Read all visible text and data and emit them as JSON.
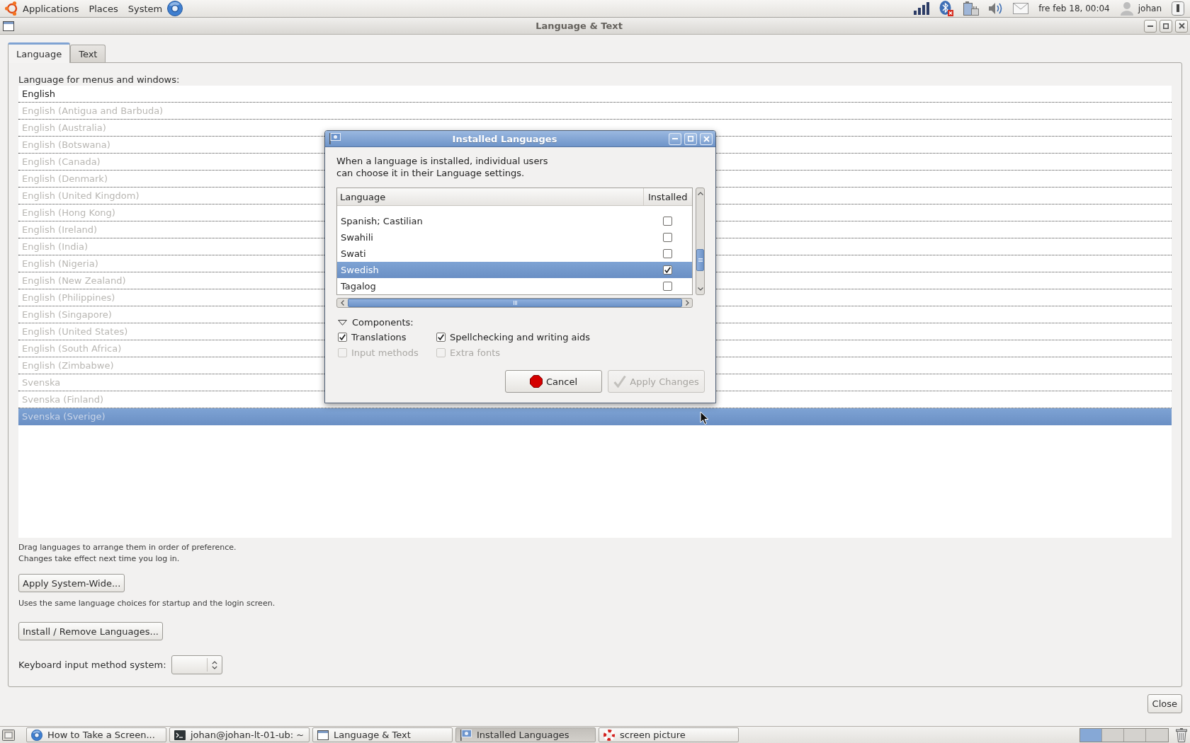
{
  "top_panel": {
    "menus": [
      "Applications",
      "Places",
      "System"
    ],
    "clock": "fre feb 18, 00:04",
    "user": "johan"
  },
  "window": {
    "title": "Language & Text",
    "tabs": [
      {
        "label": "Language",
        "selected": true
      },
      {
        "label": "Text",
        "selected": false
      }
    ],
    "list_label": "Language for menus and windows:",
    "languages": [
      {
        "name": "English",
        "disabled": false,
        "selected": false
      },
      {
        "name": "English (Antigua and Barbuda)",
        "disabled": true,
        "selected": false
      },
      {
        "name": "English (Australia)",
        "disabled": true,
        "selected": false
      },
      {
        "name": "English (Botswana)",
        "disabled": true,
        "selected": false
      },
      {
        "name": "English (Canada)",
        "disabled": true,
        "selected": false
      },
      {
        "name": "English (Denmark)",
        "disabled": true,
        "selected": false
      },
      {
        "name": "English (United Kingdom)",
        "disabled": true,
        "selected": false
      },
      {
        "name": "English (Hong Kong)",
        "disabled": true,
        "selected": false
      },
      {
        "name": "English (Ireland)",
        "disabled": true,
        "selected": false
      },
      {
        "name": "English (India)",
        "disabled": true,
        "selected": false
      },
      {
        "name": "English (Nigeria)",
        "disabled": true,
        "selected": false
      },
      {
        "name": "English (New Zealand)",
        "disabled": true,
        "selected": false
      },
      {
        "name": "English (Philippines)",
        "disabled": true,
        "selected": false
      },
      {
        "name": "English (Singapore)",
        "disabled": true,
        "selected": false
      },
      {
        "name": "English (United States)",
        "disabled": true,
        "selected": false
      },
      {
        "name": "English (South Africa)",
        "disabled": true,
        "selected": false
      },
      {
        "name": "English (Zimbabwe)",
        "disabled": true,
        "selected": false
      },
      {
        "name": "Svenska",
        "disabled": true,
        "selected": false
      },
      {
        "name": "Svenska (Finland)",
        "disabled": true,
        "selected": false
      },
      {
        "name": "Svenska (Sverige)",
        "disabled": true,
        "selected": true
      }
    ],
    "hint": "Drag languages to arrange them in order of preference.\nChanges take effect next time you log in.",
    "apply_button": "Apply System-Wide...",
    "apply_note": "Uses the same language choices for startup and the login screen.",
    "install_button": "Install / Remove Languages...",
    "keyboard_label": "Keyboard input method system:",
    "close_button": "Close"
  },
  "dialog": {
    "title": "Installed Languages",
    "description": "When a language is installed, individual users\ncan choose it in their Language settings.",
    "columns": [
      "Language",
      "Installed"
    ],
    "rows": [
      {
        "name": "Spanish; Castilian",
        "checked": false,
        "selected": false
      },
      {
        "name": "Swahili",
        "checked": false,
        "selected": false
      },
      {
        "name": "Swati",
        "checked": false,
        "selected": false
      },
      {
        "name": "Swedish",
        "checked": true,
        "selected": true
      },
      {
        "name": "Tagalog",
        "checked": false,
        "selected": false
      }
    ],
    "components": {
      "label": "Components:",
      "expanded": true,
      "options": [
        {
          "label": "Translations",
          "checked": true,
          "disabled": false
        },
        {
          "label": "Spellchecking and writing aids",
          "checked": true,
          "disabled": false
        },
        {
          "label": "Input methods",
          "checked": false,
          "disabled": true
        },
        {
          "label": "Extra fonts",
          "checked": false,
          "disabled": true
        }
      ]
    },
    "buttons": [
      {
        "label": "Cancel",
        "kind": "cancel",
        "disabled": false
      },
      {
        "label": "Apply Changes",
        "kind": "apply",
        "disabled": true
      }
    ]
  },
  "taskbar": {
    "windows": [
      {
        "title": "How to Take a Screen...",
        "kind": "browser",
        "selected": false
      },
      {
        "title": "johan@johan-lt-01-ub: ~",
        "kind": "terminal",
        "selected": false
      },
      {
        "title": "Language & Text",
        "kind": "window",
        "selected": false
      },
      {
        "title": "Installed Languages",
        "kind": "dialog",
        "selected": true
      },
      {
        "title": "screen picture",
        "kind": "help",
        "selected": false
      }
    ],
    "workspaces": [
      {
        "selected": true
      },
      {
        "selected": false
      },
      {
        "selected": false
      },
      {
        "selected": false
      }
    ]
  }
}
